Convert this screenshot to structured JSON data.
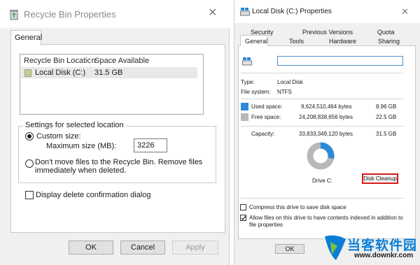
{
  "recycle_bin": {
    "title": "Recycle Bin Properties",
    "tab": "General",
    "list": {
      "columns": [
        "Recycle Bin Location",
        "Space Available"
      ],
      "rows": [
        {
          "location": "Local Disk (C:)",
          "space": "31.5 GB"
        }
      ]
    },
    "settings_legend": "Settings for selected location",
    "custom_size_label": "Custom size:",
    "max_size_label": "Maximum size (MB):",
    "max_size_value": "3226",
    "dont_move_line1": "Don't move files to the Recycle Bin. Remove files",
    "dont_move_line2": "immediately when deleted.",
    "confirm_label": "Display delete confirmation dialog",
    "buttons": {
      "ok": "OK",
      "cancel": "Cancel",
      "apply": "Apply"
    }
  },
  "local_disk": {
    "title": "Local Disk (C:) Properties",
    "tabs_row1": [
      "Security",
      "Previous Versions",
      "Quota"
    ],
    "tabs_row2": [
      "General",
      "Tools",
      "Hardware",
      "Sharing"
    ],
    "type_label": "Type:",
    "type_value": "Local Disk",
    "fs_label": "File system:",
    "fs_value": "NTFS",
    "used_label": "Used space:",
    "used_bytes": "9,624,510,464 bytes",
    "used_gb": "8.96 GB",
    "free_label": "Free space:",
    "free_bytes": "24,208,838,656 bytes",
    "free_gb": "22.5 GB",
    "capacity_label": "Capacity:",
    "capacity_bytes": "33,833,349,120 bytes",
    "capacity_gb": "31.5 GB",
    "drive_label": "Drive C:",
    "cleanup_label": "Disk Cleanup",
    "compress_label": "Compress this drive to save disk space",
    "index_line1": "Allow files on this drive to have contents indexed in addition to",
    "index_line2": "file properties",
    "ok_label": "OK",
    "used_fraction": 0.285,
    "colors": {
      "used": "#2a8ad8",
      "free": "#b8b8b8",
      "highlight": "#d21b1b"
    }
  },
  "watermark": {
    "brand": "当客软件园",
    "url": "www.downkr.com"
  }
}
